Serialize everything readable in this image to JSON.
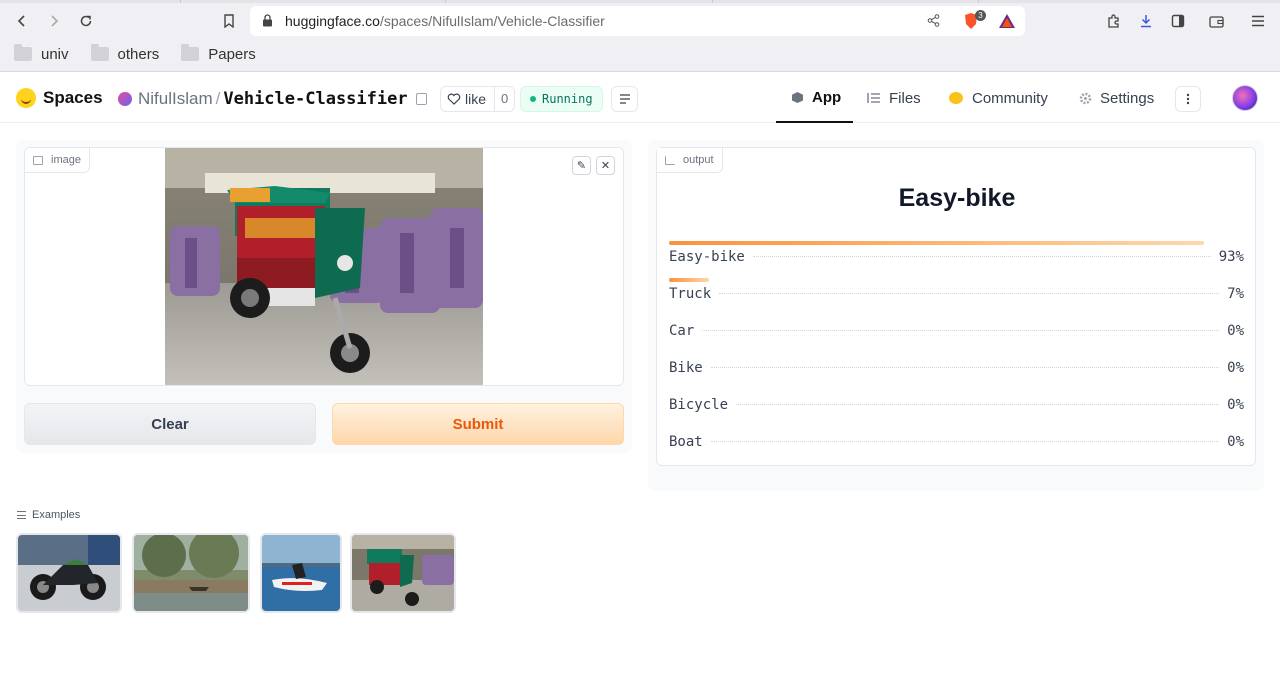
{
  "browser": {
    "url_host": "huggingface.co",
    "url_path": "/spaces/NifulIslam/Vehicle-Classifier",
    "extension_badge": "3",
    "bookmarks": [
      {
        "label": "univ"
      },
      {
        "label": "others"
      },
      {
        "label": "Papers"
      }
    ]
  },
  "header": {
    "brand": "Spaces",
    "owner": "NifulIslam",
    "separator": "/",
    "repo": "Vehicle-Classifier",
    "like_label": "like",
    "like_count": "0",
    "status": "Running",
    "tabs": [
      {
        "label": "App"
      },
      {
        "label": "Files"
      },
      {
        "label": "Community"
      },
      {
        "label": "Settings"
      }
    ]
  },
  "input_panel": {
    "label": "image",
    "clear_label": "Clear",
    "submit_label": "Submit"
  },
  "output_panel": {
    "label": "output",
    "top_prediction": "Easy-bike",
    "confidences": [
      {
        "label": "Easy-bike",
        "value": "93%",
        "fraction": 0.93
      },
      {
        "label": "Truck",
        "value": "7%",
        "fraction": 0.07
      },
      {
        "label": "Car",
        "value": "0%",
        "fraction": 0
      },
      {
        "label": "Bike",
        "value": "0%",
        "fraction": 0
      },
      {
        "label": "Bicycle",
        "value": "0%",
        "fraction": 0
      },
      {
        "label": "Boat",
        "value": "0%",
        "fraction": 0
      }
    ]
  },
  "examples": {
    "label": "Examples",
    "items": [
      "motorbike",
      "river-boat",
      "jet-ski",
      "easy-bike"
    ]
  },
  "colors": {
    "accent": "#ea580c",
    "status_green": "#10b981"
  }
}
